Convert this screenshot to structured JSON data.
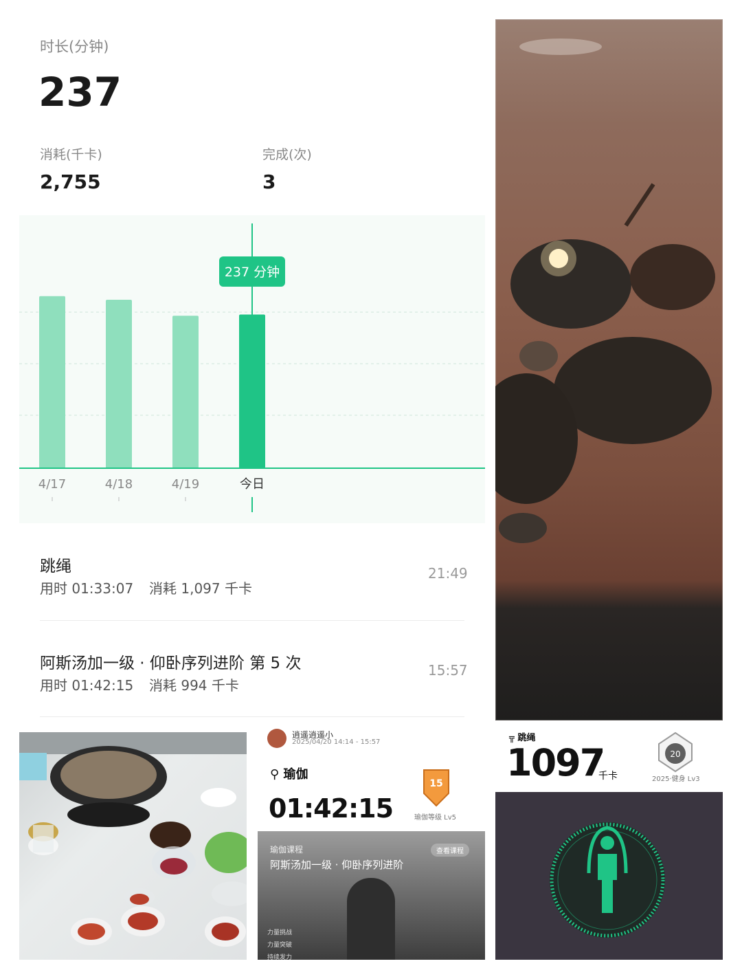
{
  "summary": {
    "duration_label": "时长(分钟)",
    "duration_value": "237",
    "calories_label": "消耗(千卡)",
    "calories_value": "2,755",
    "completed_label": "完成(次)",
    "completed_value": "3"
  },
  "chart_data": {
    "type": "bar",
    "categories": [
      "4/17",
      "4/18",
      "4/19",
      "今日"
    ],
    "values": [
      290,
      284,
      257,
      259
    ],
    "highlight_index": 3,
    "tooltip": "237 分钟",
    "colors": {
      "bar": "#8fdfbd",
      "highlight": "#1fc486",
      "axis": "#1fc486",
      "tooltip_bg": "#1fc486"
    }
  },
  "records": [
    {
      "title": "跳绳",
      "duration": "用时 01:33:07",
      "calories": "消耗 1,097 千卡",
      "time": "21:49"
    },
    {
      "title": "阿斯汤加一级 · 仰卧序列进阶 第 5 次",
      "duration": "用时 01:42:15",
      "calories": "消耗 994 千卡",
      "time": "15:57"
    }
  ],
  "yoga_card": {
    "user": "逍遥逍遥小",
    "datetime": "2025/04/20 14:14 - 15:57",
    "sport": "瑜伽",
    "duration": "01:42:15",
    "level_badge": "15",
    "level_label": "瑜伽等级 Lv5",
    "course_tag": "瑜伽课程",
    "course_button": "查看课程",
    "course_name": "阿斯汤加一级 · 仰卧序列进阶",
    "course_items": [
      "力量挑战",
      "力量突破",
      "持续发力"
    ]
  },
  "jump_card": {
    "sport": "跳绳",
    "calories": "1097",
    "unit": "千卡",
    "badge_number": "20",
    "badge_label": "2025·健身 Lv3"
  }
}
